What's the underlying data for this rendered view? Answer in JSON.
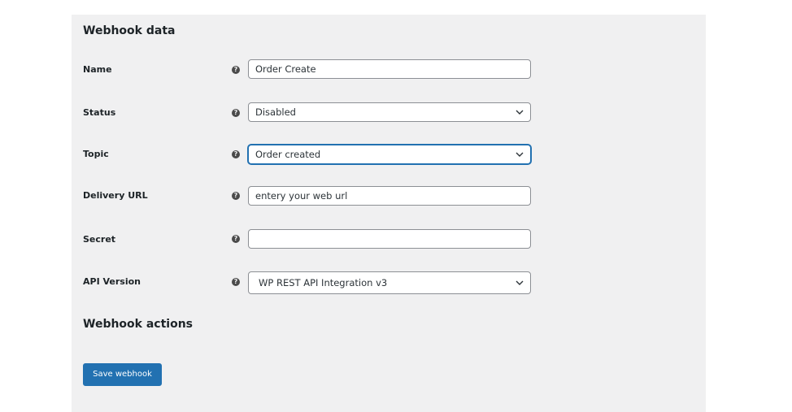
{
  "sections": {
    "webhook_data": "Webhook data",
    "webhook_actions": "Webhook actions"
  },
  "fields": {
    "name": {
      "label": "Name",
      "value": "Order Create"
    },
    "status": {
      "label": "Status",
      "value": "Disabled"
    },
    "topic": {
      "label": "Topic",
      "value": "Order created"
    },
    "delivery_url": {
      "label": "Delivery URL",
      "value": "entery your web url"
    },
    "secret": {
      "label": "Secret",
      "value": ""
    },
    "api_version": {
      "label": "API Version",
      "value": "WP REST API Integration v3"
    }
  },
  "help_icon_glyph": "?",
  "actions": {
    "save_label": "Save webhook"
  },
  "colors": {
    "accent": "#2271b1",
    "panel_bg": "#f0f0f1"
  }
}
